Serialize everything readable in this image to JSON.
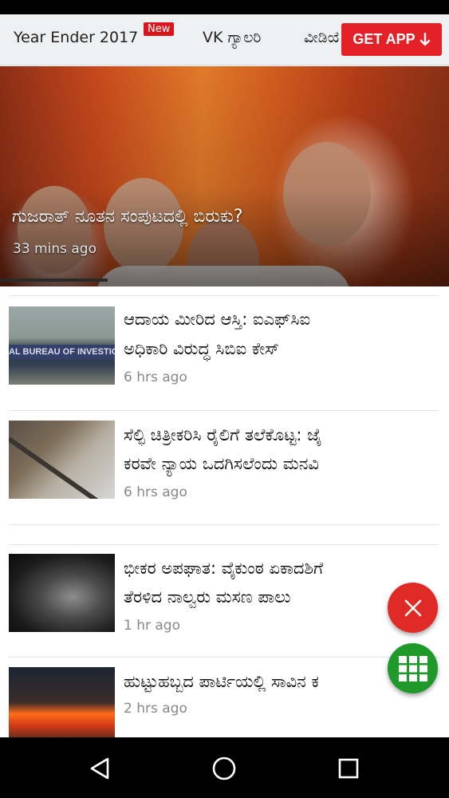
{
  "top_nav": {
    "tabs": [
      "Year Ender 2017",
      "VK ಗ್ಯಾಲರಿ",
      "ವೀಡಿಯೊ"
    ],
    "new_badge": "New",
    "get_app_label": "GET APP",
    "get_app_color": "#e32127"
  },
  "hero": {
    "title": "ಗುಜರಾತ್ ನೂತನ ಸಂಪುಟದಲ್ಲಿ ಬಿರುಕು?",
    "time": "33 mins ago"
  },
  "articles": [
    {
      "title_line1": "ಆದಾಯ ಮೀರಿದ ಆಸ್ತಿ: ಐಎಫ್‌ಸಿಐ",
      "title_line2": "ಅಧಿಕಾರಿ ವಿರುದ್ಧ ಸಿಬಿಐ ಕೇಸ್",
      "time": "6 hrs ago",
      "thumb_text": "AL BUREAU OF INVESTIG"
    },
    {
      "title_line1": "ಸೆಲ್ಫಿ ಚಿತ್ರೀಕರಿಸಿ ರೈಲಿಗೆ ತಲೆಕೊಟ್ಟ: ಜೈ",
      "title_line2": "ಕರವೇ ನ್ಯಾಯ ಒದಗಿಸಲೆಂದು ಮನವಿ",
      "time": "6 hrs ago"
    },
    {
      "title_line1": "ಭೀಕರ ಅಪಘಾತ: ವೈಕುಂಠ ಏಕಾದಶಿಗೆ",
      "title_line2": "ತೆರಳಿದ ನಾಲ್ವರು ಮಸಣ ಪಾಲು",
      "time": "1 hr ago"
    },
    {
      "title_line1": "ಹುಟ್ಟುಹಬ್ಬದ ಪಾರ್ಟಿಯಲ್ಲಿ ಸಾವಿನ ಕ",
      "time": "2 hrs ago"
    }
  ],
  "fab": {
    "close_icon": "close-icon",
    "close_color": "#e02a26",
    "grid_icon": "grid-icon",
    "grid_color": "#1f9a2a"
  },
  "system_nav": {
    "icons": [
      "back-icon",
      "home-icon",
      "recents-icon"
    ]
  }
}
